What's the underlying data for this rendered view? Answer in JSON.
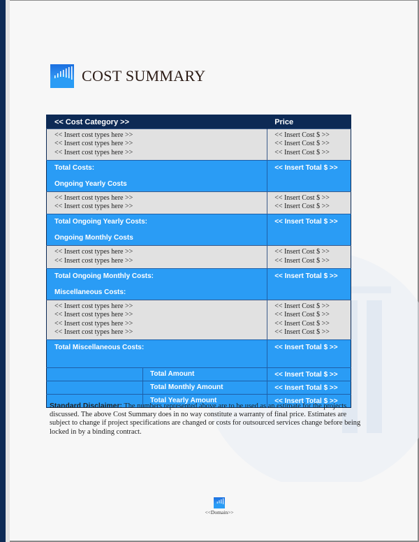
{
  "document": {
    "title": "COST SUMMARY",
    "colors": {
      "navy": "#0d2a55",
      "accent_blue": "#2a9cf5",
      "item_gray": "#e1e1e1",
      "title_text": "#2a1a14"
    }
  },
  "table": {
    "header": {
      "category": "<< Cost Category >>",
      "price": "Price"
    },
    "sections": [
      {
        "items": [
          {
            "label": "<< Insert cost types here >>",
            "price": "<< Insert Cost $ >>"
          },
          {
            "label": "<< Insert cost types here >>",
            "price": "<< Insert Cost $ >>"
          },
          {
            "label": "<< Insert cost types here >>",
            "price": "<< Insert Cost $ >>"
          }
        ],
        "total_label": "Total Costs:",
        "total_value": "<< Insert Total $ >>",
        "next_section_label": "Ongoing Yearly Costs"
      },
      {
        "items": [
          {
            "label": "<< Insert cost types here >>",
            "price": "<< Insert Cost $ >>"
          },
          {
            "label": "<< Insert cost types here >>",
            "price": "<< Insert Cost $ >>"
          }
        ],
        "total_label": "Total Ongoing Yearly Costs:",
        "total_value": "<< Insert Total $ >>",
        "next_section_label": "Ongoing Monthly Costs"
      },
      {
        "items": [
          {
            "label": "<< Insert cost types here >>",
            "price": "<< Insert Cost $ >>"
          },
          {
            "label": "<< Insert cost types here >>",
            "price": "<< Insert Cost $ >>"
          }
        ],
        "total_label": "Total Ongoing Monthly Costs:",
        "total_value": "<< Insert Total $ >>",
        "next_section_label": "Miscellaneous Costs:"
      },
      {
        "items": [
          {
            "label": "<< Insert cost types here >>",
            "price": "<< Insert Cost $ >>"
          },
          {
            "label": "<< Insert cost types here >>",
            "price": "<< Insert Cost $ >>"
          },
          {
            "label": "<< Insert cost types here >>",
            "price": "<< Insert Cost $ >>"
          },
          {
            "label": "<< Insert cost types here >>",
            "price": "<< Insert Cost $ >>"
          }
        ],
        "total_label": "Total Miscellaneous Costs:",
        "total_value": "<< Insert Total $ >>"
      }
    ],
    "grand_totals": [
      {
        "label": "Total Amount",
        "value": "<< Insert Total $ >>"
      },
      {
        "label": "Total Monthly Amount",
        "value": "<< Insert Total $ >>"
      },
      {
        "label": "Total Yearly Amount",
        "value": "<< Insert Total $ >>"
      }
    ]
  },
  "disclaimer": {
    "heading": "Standard Disclaimer:",
    "text": " The numbers represented above are to be used as an estimate for the projects discussed. The above Cost Summary does in no way constitute a warranty of final price.  Estimates are subject to change if project specifications are changed or costs for outsourced services change before being locked in by a binding contract."
  },
  "footer": {
    "logo_icon": "building-columns-logo",
    "domain": "<<Domain>>"
  }
}
